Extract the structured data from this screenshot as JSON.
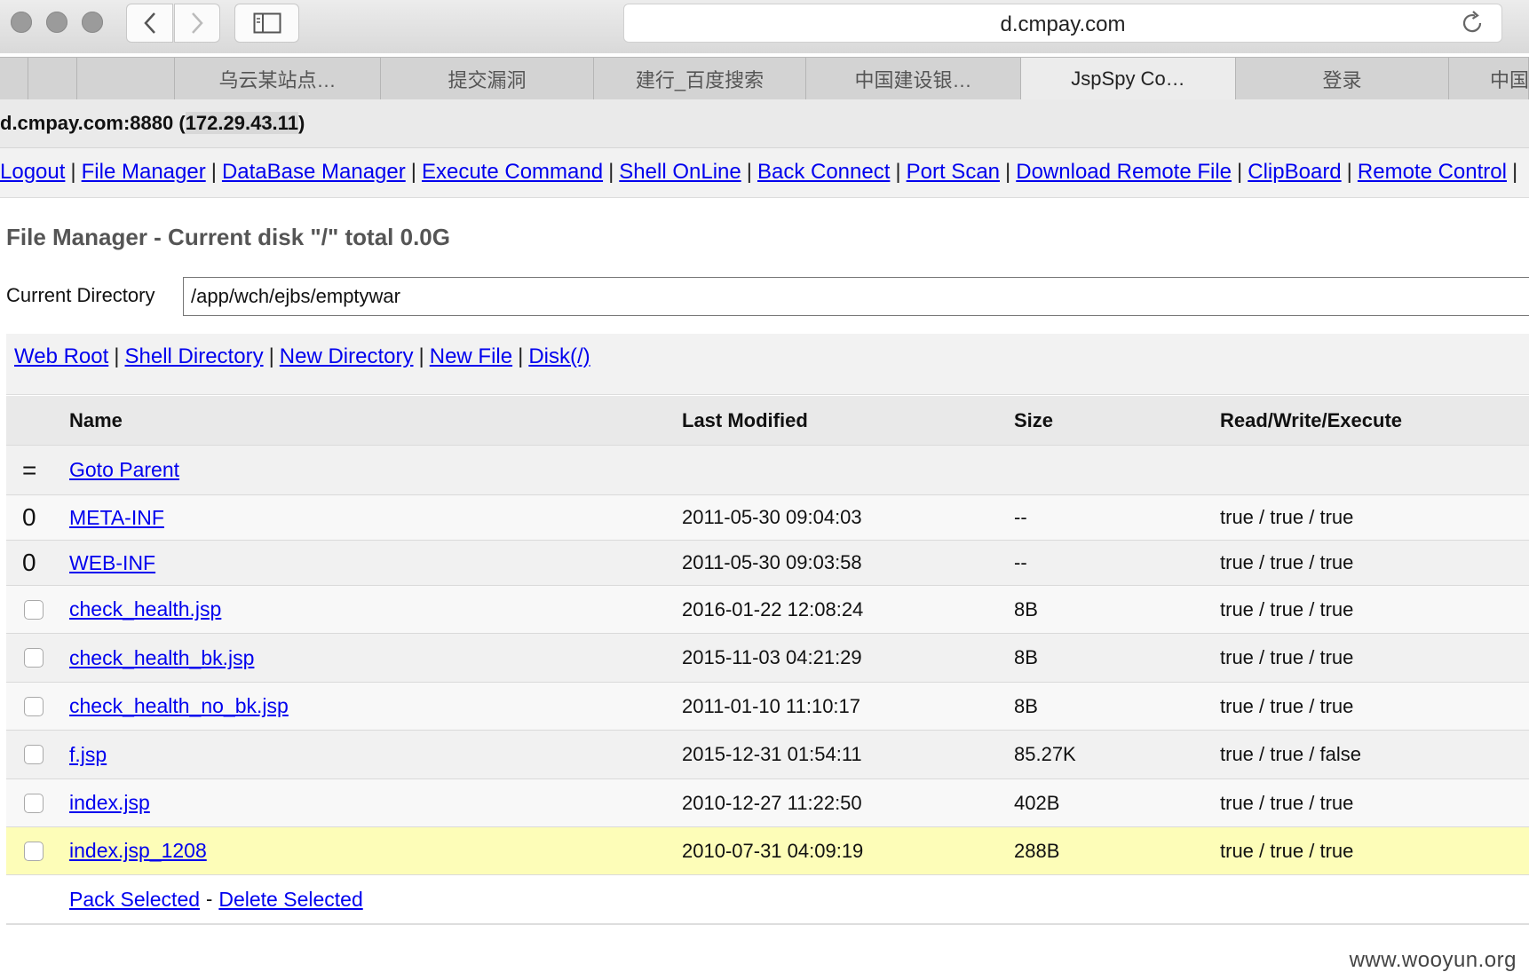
{
  "browser": {
    "url": "d.cmpay.com",
    "tabs": [
      "",
      "",
      "乌云某站点…",
      "提交漏洞",
      "建行_百度搜索",
      "中国建设银…",
      "JspSpy Co…",
      "登录",
      "中国"
    ]
  },
  "host": {
    "prefix": "d.cmpay.com:8880 (",
    "ip": "172.29.43.11",
    "suffix": ")"
  },
  "menu": [
    "Logout",
    "File Manager",
    "DataBase Manager",
    "Execute Command",
    "Shell OnLine",
    "Back Connect",
    "Port Scan",
    "Download Remote File",
    "ClipBoard",
    "Remote Control"
  ],
  "menu_sep": "|",
  "file_manager": {
    "title": "File Manager - Current disk \"/\" total 0.0G",
    "current_dir_label": "Current Directory",
    "current_dir_value": "/app/wch/ejbs/emptywar"
  },
  "quick_links": [
    "Web Root",
    "Shell Directory",
    "New Directory",
    "New File",
    "Disk(/)"
  ],
  "table": {
    "headers": [
      "Name",
      "Last Modified",
      "Size",
      "Read/Write/Execute"
    ],
    "parent": {
      "marker": "=",
      "label": "Goto Parent"
    },
    "rows": [
      {
        "marker": "0",
        "name": "META-INF",
        "modified": "2011-05-30 09:04:03",
        "size": "--",
        "rwx": "true / true / true"
      },
      {
        "marker": "0",
        "name": "WEB-INF",
        "modified": "2011-05-30 09:03:58",
        "size": "--",
        "rwx": "true / true / true"
      },
      {
        "name": "check_health.jsp",
        "modified": "2016-01-22 12:08:24",
        "size": "8B",
        "rwx": "true / true / true"
      },
      {
        "name": "check_health_bk.jsp",
        "modified": "2015-11-03 04:21:29",
        "size": "8B",
        "rwx": "true / true / true"
      },
      {
        "name": "check_health_no_bk.jsp",
        "modified": "2011-01-10 11:10:17",
        "size": "8B",
        "rwx": "true / true / true"
      },
      {
        "name": "f.jsp",
        "modified": "2015-12-31 01:54:11",
        "size": "85.27K",
        "rwx": "true / true / false"
      },
      {
        "name": "index.jsp",
        "modified": "2010-12-27 11:22:50",
        "size": "402B",
        "rwx": "true / true / true"
      },
      {
        "name": "index.jsp_1208",
        "modified": "2010-07-31 04:09:19",
        "size": "288B",
        "rwx": "true / true / true"
      }
    ],
    "footer": {
      "pack": "Pack Selected",
      "dash": "-",
      "delete": "Delete Selected"
    }
  },
  "highlight_color": "#fdfdb8",
  "link_color": "#0000ee",
  "watermark": "www.wooyun.org"
}
